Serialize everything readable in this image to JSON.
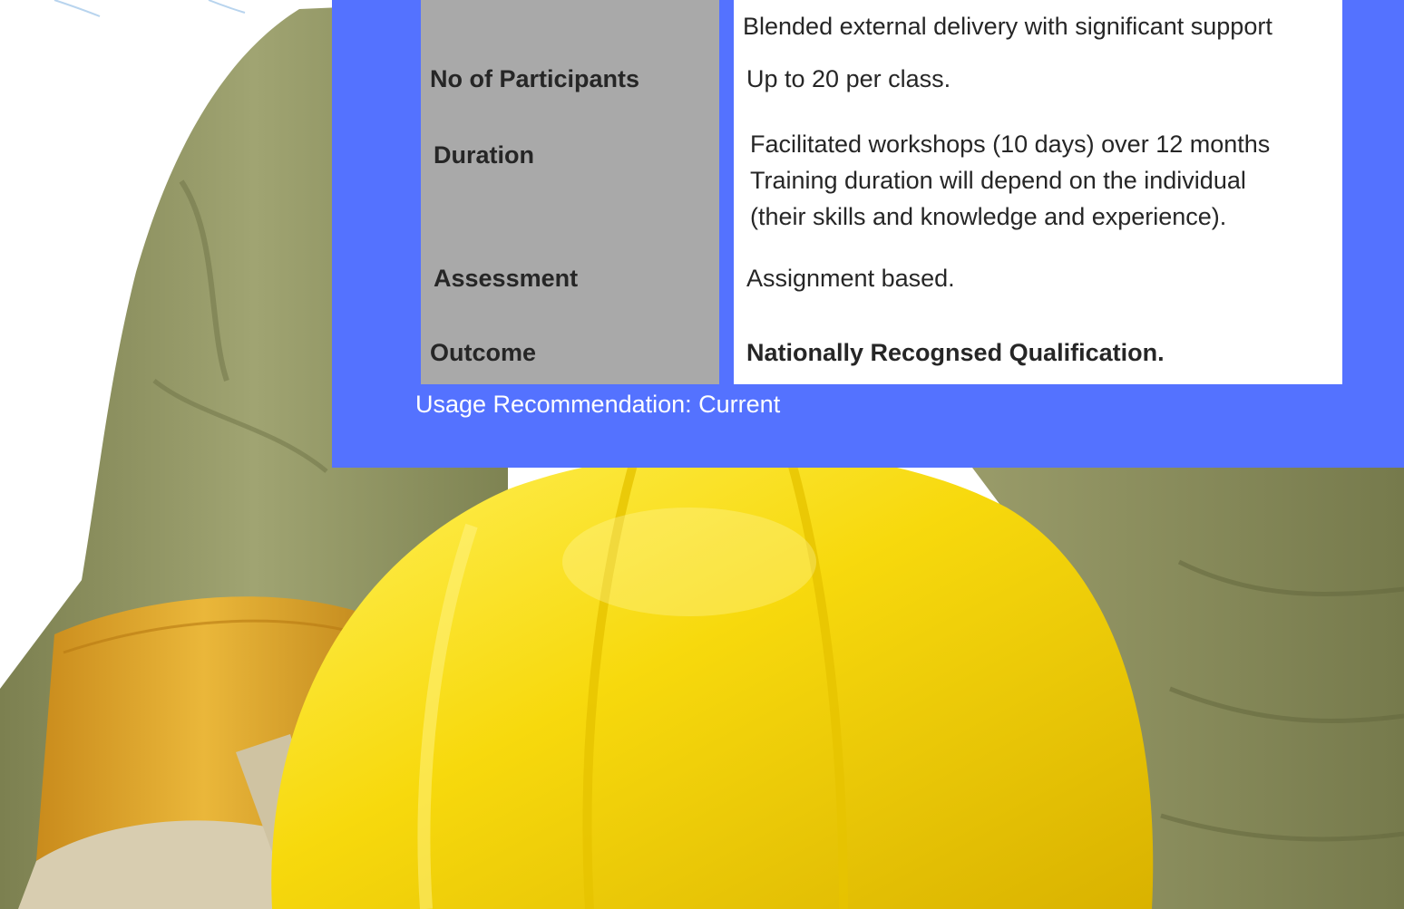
{
  "table": {
    "rows": [
      {
        "label": "",
        "values": [
          "",
          "Blended external delivery with significant support"
        ]
      },
      {
        "label": "No of Participants",
        "values": [
          "Up to 20 per class."
        ]
      },
      {
        "label": "Duration",
        "values": [
          "Facilitated workshops (10 days) over 12 months",
          "Training duration will depend on the individual",
          "(their skills and knowledge and experience)."
        ]
      },
      {
        "label": "Assessment",
        "values": [
          "Assignment based."
        ]
      },
      {
        "label": "Outcome",
        "values": [
          "Nationally Recognsed Qualification."
        ]
      }
    ]
  },
  "usage": "Usage Recommendation: Current",
  "colors": {
    "panel": "#5472ff",
    "label_column": "#a9a9a9",
    "value_column": "#ffffff",
    "helmet": "#f6d80c",
    "uniform": "#8f9463",
    "glove_cuff": "#e0a92a"
  }
}
